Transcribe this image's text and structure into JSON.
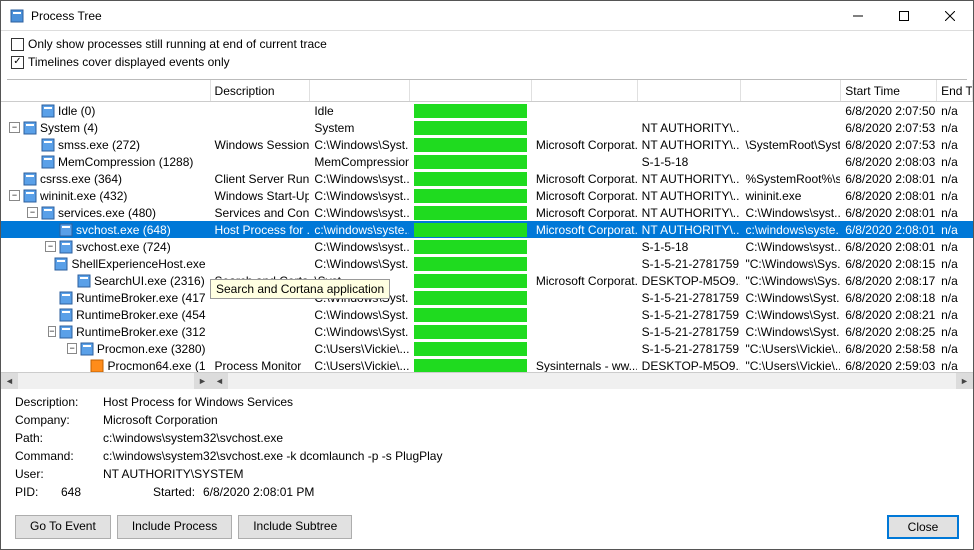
{
  "window": {
    "title": "Process Tree"
  },
  "checkboxes": {
    "only_running": {
      "label": "Only show processes still running at end of current trace",
      "checked": false
    },
    "timelines": {
      "label": "Timelines cover displayed events only",
      "checked": true
    }
  },
  "columns": {
    "tree": "",
    "description": "Description",
    "image_path": "",
    "life_time": "",
    "company": "",
    "user": "",
    "command": "",
    "start_time": "Start Time",
    "end_time": "End Tim"
  },
  "rows": [
    {
      "indent": 1,
      "toggle": "",
      "icon": "app",
      "name": "Idle (0)",
      "desc": "",
      "img": "Idle",
      "life": true,
      "company": "",
      "user": "",
      "cmd": "",
      "start": "6/8/2020 2:07:50...",
      "end": "n/a",
      "selected": false
    },
    {
      "indent": 0,
      "toggle": "-",
      "icon": "app",
      "name": "System (4)",
      "desc": "",
      "img": "System",
      "life": true,
      "company": "",
      "user": "NT AUTHORITY\\...",
      "cmd": "",
      "start": "6/8/2020 2:07:53...",
      "end": "n/a",
      "selected": false
    },
    {
      "indent": 1,
      "toggle": "",
      "icon": "app",
      "name": "smss.exe (272)",
      "desc": "Windows Session ...",
      "img": "C:\\Windows\\Syst...",
      "life": true,
      "company": "Microsoft Corporat...",
      "user": "NT AUTHORITY\\...",
      "cmd": "\\SystemRoot\\Syst...",
      "start": "6/8/2020 2:07:53...",
      "end": "n/a",
      "selected": false
    },
    {
      "indent": 1,
      "toggle": "",
      "icon": "app",
      "name": "MemCompression (1288)",
      "desc": "",
      "img": "MemCompression",
      "life": true,
      "company": "",
      "user": "S-1-5-18",
      "cmd": "",
      "start": "6/8/2020 2:08:03...",
      "end": "n/a",
      "selected": false
    },
    {
      "indent": 0,
      "toggle": "",
      "icon": "app",
      "name": "csrss.exe (364)",
      "desc": "Client Server Runt...",
      "img": "C:\\Windows\\syst...",
      "life": true,
      "company": "Microsoft Corporat...",
      "user": "NT AUTHORITY\\...",
      "cmd": "%SystemRoot%\\s...",
      "start": "6/8/2020 2:08:01...",
      "end": "n/a",
      "selected": false
    },
    {
      "indent": 0,
      "toggle": "-",
      "icon": "app",
      "name": "wininit.exe (432)",
      "desc": "Windows Start-Up...",
      "img": "C:\\Windows\\syst...",
      "life": true,
      "company": "Microsoft Corporat...",
      "user": "NT AUTHORITY\\...",
      "cmd": "wininit.exe",
      "start": "6/8/2020 2:08:01...",
      "end": "n/a",
      "selected": false
    },
    {
      "indent": 1,
      "toggle": "-",
      "icon": "app",
      "name": "services.exe (480)",
      "desc": "Services and Cont...",
      "img": "C:\\Windows\\syst...",
      "life": true,
      "company": "Microsoft Corporat...",
      "user": "NT AUTHORITY\\...",
      "cmd": "C:\\Windows\\syst...",
      "start": "6/8/2020 2:08:01...",
      "end": "n/a",
      "selected": false
    },
    {
      "indent": 2,
      "toggle": "",
      "icon": "app",
      "name": "svchost.exe (648)",
      "desc": "Host Process for ...",
      "img": "c:\\windows\\syste...",
      "life": true,
      "company": "Microsoft Corporat...",
      "user": "NT AUTHORITY\\...",
      "cmd": "c:\\windows\\syste...",
      "start": "6/8/2020 2:08:01...",
      "end": "n/a",
      "selected": true
    },
    {
      "indent": 2,
      "toggle": "-",
      "icon": "app",
      "name": "svchost.exe (724)",
      "desc": "",
      "img": "C:\\Windows\\syst...",
      "life": true,
      "company": "",
      "user": "S-1-5-18",
      "cmd": "C:\\Windows\\syst...",
      "start": "6/8/2020 2:08:01...",
      "end": "n/a",
      "selected": false
    },
    {
      "indent": 3,
      "toggle": "",
      "icon": "app",
      "name": "ShellExperienceHost.exe",
      "desc": "",
      "img": "C:\\Windows\\Syst...",
      "life": true,
      "company": "",
      "user": "S-1-5-21-2781759...",
      "cmd": "\"C:\\Windows\\Sys...",
      "start": "6/8/2020 2:08:15...",
      "end": "n/a",
      "selected": false
    },
    {
      "indent": 3,
      "toggle": "",
      "icon": "app",
      "name": "SearchUI.exe (2316)",
      "desc": "Search and Cortana application",
      "img": "\\Syst...",
      "life": true,
      "company": "Microsoft Corporat...",
      "user": "DESKTOP-M5O9...",
      "cmd": "\"C:\\Windows\\Sys...",
      "start": "6/8/2020 2:08:17...",
      "end": "n/a",
      "selected": false
    },
    {
      "indent": 3,
      "toggle": "",
      "icon": "app",
      "name": "RuntimeBroker.exe (417",
      "desc": "",
      "img": "C:\\Windows\\Syst...",
      "life": true,
      "company": "",
      "user": "S-1-5-21-2781759...",
      "cmd": "C:\\Windows\\Syst...",
      "start": "6/8/2020 2:08:18...",
      "end": "n/a",
      "selected": false
    },
    {
      "indent": 3,
      "toggle": "",
      "icon": "app",
      "name": "RuntimeBroker.exe (454",
      "desc": "",
      "img": "C:\\Windows\\Syst...",
      "life": true,
      "company": "",
      "user": "S-1-5-21-2781759...",
      "cmd": "C:\\Windows\\Syst...",
      "start": "6/8/2020 2:08:21...",
      "end": "n/a",
      "selected": false
    },
    {
      "indent": 3,
      "toggle": "-",
      "icon": "app",
      "name": "RuntimeBroker.exe (312",
      "desc": "",
      "img": "C:\\Windows\\Syst...",
      "life": true,
      "company": "",
      "user": "S-1-5-21-2781759...",
      "cmd": "C:\\Windows\\Syst...",
      "start": "6/8/2020 2:08:25...",
      "end": "n/a",
      "selected": false
    },
    {
      "indent": 4,
      "toggle": "-",
      "icon": "app",
      "name": "Procmon.exe (3280)",
      "desc": "",
      "img": "C:\\Users\\Vickie\\...",
      "life": true,
      "company": "",
      "user": "S-1-5-21-2781759...",
      "cmd": "\"C:\\Users\\Vickie\\...",
      "start": "6/8/2020 2:58:58...",
      "end": "n/a",
      "selected": false
    },
    {
      "indent": 5,
      "toggle": "",
      "icon": "pm",
      "name": "Procmon64.exe (1",
      "desc": "Process Monitor",
      "img": "C:\\Users\\Vickie\\...",
      "life": true,
      "company": "Sysinternals - ww...",
      "user": "DESKTOP-M5O9...",
      "cmd": "\"C:\\Users\\Vickie\\...",
      "start": "6/8/2020 2:59:03...",
      "end": "n/a",
      "selected": false
    }
  ],
  "tooltip": "Search and Cortana application",
  "details": {
    "description_label": "Description:",
    "description_value": "Host Process for Windows Services",
    "company_label": "Company:",
    "company_value": "Microsoft Corporation",
    "path_label": "Path:",
    "path_value": "c:\\windows\\system32\\svchost.exe",
    "command_label": "Command:",
    "command_value": "c:\\windows\\system32\\svchost.exe -k dcomlaunch -p -s PlugPlay",
    "user_label": "User:",
    "user_value": "NT AUTHORITY\\SYSTEM",
    "pid_label": "PID:",
    "pid_value": "648",
    "started_label": "Started:",
    "started_value": "6/8/2020 2:08:01 PM"
  },
  "buttons": {
    "go_to_event": "Go To Event",
    "include_process": "Include Process",
    "include_subtree": "Include Subtree",
    "close": "Close"
  }
}
